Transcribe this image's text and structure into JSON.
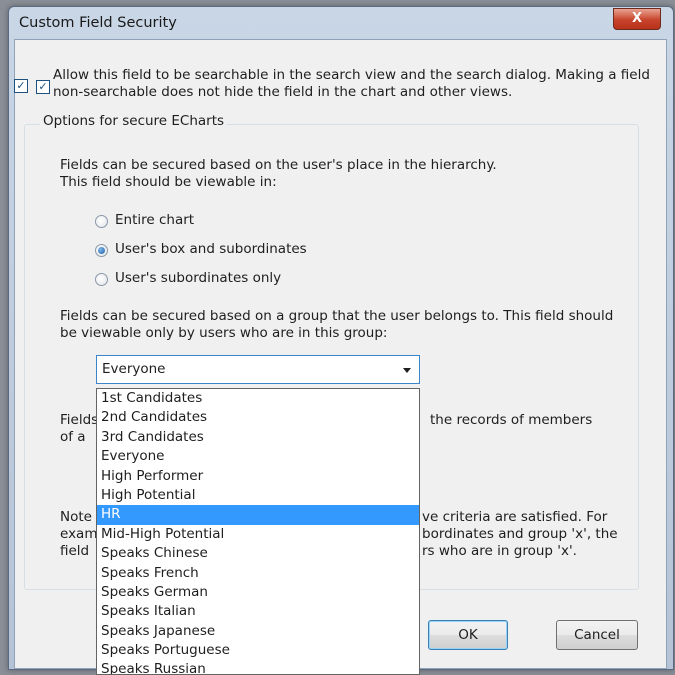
{
  "window": {
    "title": "Custom Field Security",
    "close_label": "X"
  },
  "searchable": {
    "checked": true,
    "label": "Allow this field to be searchable in the search view and the search dialog. Making a field non-searchable does not hide the field in the chart and other views."
  },
  "secure_group": {
    "legend": "Options for secure ECharts",
    "hierarchy_text": "Fields can be secured based on the user's place in the hierarchy. This field should be viewable in:",
    "radio_options": [
      {
        "label": "Entire chart",
        "selected": false
      },
      {
        "label": "User's box and subordinates",
        "selected": true
      },
      {
        "label": "User's subordinates only",
        "selected": false
      }
    ],
    "group_text": "Fields can be secured based on a group that the user belongs to. This field should be viewable only by users who are in this group:",
    "group_select": {
      "value": "Everyone",
      "options": [
        "1st Candidates",
        "2nd Candidates",
        "3rd Candidates",
        "Everyone",
        "High Performer",
        "High Potential",
        "HR",
        "Mid-High Potential",
        "Speaks Chinese",
        "Speaks French",
        "Speaks German",
        "Speaks Italian",
        "Speaks Japanese",
        "Speaks Portuguese",
        "Speaks Russian"
      ],
      "highlighted": "HR"
    },
    "members_text": {
      "start": "Fields",
      "end": "the records of members",
      "line2_start": "of a"
    },
    "note_text": {
      "l1_start": "Note",
      "l1_end": "ve criteria are satisfied. For",
      "l2_start": "exam",
      "l2_end": "bordinates and group 'x', the",
      "l3_start": "field",
      "l3_end": "rs who are in group 'x'."
    }
  },
  "buttons": {
    "ok": "OK",
    "cancel": "Cancel"
  }
}
